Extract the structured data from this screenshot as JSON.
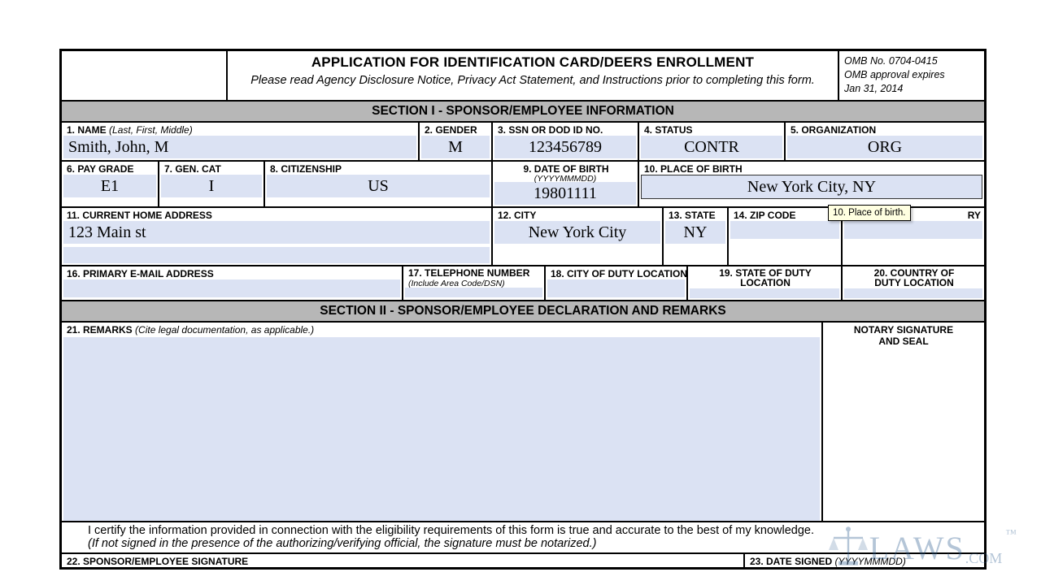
{
  "header": {
    "title": "APPLICATION FOR IDENTIFICATION CARD/DEERS ENROLLMENT",
    "subtitle": "Please read Agency Disclosure Notice, Privacy Act Statement, and Instructions prior to completing this form.",
    "omb_no": "OMB No. 0704-0415",
    "omb_approval": "OMB approval expires",
    "omb_date": "Jan 31, 2014"
  },
  "section1": {
    "title": "SECTION I - SPONSOR/EMPLOYEE INFORMATION",
    "f1": {
      "label": "1.  NAME",
      "hint": "(Last, First, Middle)",
      "value": "Smith, John, M"
    },
    "f2": {
      "label": "2.  GENDER",
      "value": "M"
    },
    "f3": {
      "label": "3.  SSN OR DOD ID NO.",
      "value": "123456789"
    },
    "f4": {
      "label": "4.  STATUS",
      "value": "CONTR"
    },
    "f5": {
      "label": "5.  ORGANIZATION",
      "value": "ORG"
    },
    "f6": {
      "label": "6.  PAY GRADE",
      "value": "E1"
    },
    "f7": {
      "label": "7.  GEN. CAT",
      "value": "I"
    },
    "f8": {
      "label": "8. CITIZENSHIP",
      "value": "US"
    },
    "f9": {
      "label": "9.  DATE OF BIRTH",
      "hint": "(YYYYMMMDD)",
      "value": "19801111"
    },
    "f10": {
      "label": "10.  PLACE OF BIRTH",
      "value": "New York City, NY"
    },
    "f11": {
      "label": "11.  CURRENT HOME ADDRESS",
      "value": "123 Main st"
    },
    "f12": {
      "label": "12.  CITY",
      "value": "New York City"
    },
    "f13": {
      "label": "13.  STATE",
      "value": "NY"
    },
    "f14": {
      "label": "14.  ZIP CODE",
      "value": ""
    },
    "f15": {
      "label": "RY",
      "value": ""
    },
    "f16": {
      "label": "16.  PRIMARY E-MAIL ADDRESS",
      "value": ""
    },
    "f17": {
      "label": "17.  TELEPHONE NUMBER",
      "hint": "(Include Area Code/DSN)",
      "value": ""
    },
    "f18": {
      "label": "18.  CITY OF DUTY LOCATION",
      "value": ""
    },
    "f19": {
      "label1": "19.  STATE OF DUTY",
      "label2": "LOCATION",
      "value": ""
    },
    "f20": {
      "label1": "20.  COUNTRY OF",
      "label2": "DUTY LOCATION",
      "value": ""
    }
  },
  "section2": {
    "title": "SECTION II - SPONSOR/EMPLOYEE DECLARATION AND REMARKS",
    "f21": {
      "label": "21.  REMARKS",
      "hint": "(Cite legal documentation, as applicable.)"
    },
    "notary": {
      "label1": "NOTARY SIGNATURE",
      "label2": "AND SEAL"
    },
    "cert_line1": "I certify the information provided in connection with the eligibility requirements of this form is true and accurate to the best of my knowledge.",
    "cert_line2": "(If not signed in the presence of the authorizing/verifying official, the signature must be notarized.)",
    "f22": {
      "label": "22.  SPONSOR/EMPLOYEE SIGNATURE"
    },
    "f23": {
      "label": "23.  DATE SIGNED",
      "hint": "(YYYYMMMDD)"
    }
  },
  "tooltip": "10. Place of birth.",
  "watermark": {
    "text": "LAWS",
    "suffix": ".COM",
    "tm": "™"
  }
}
